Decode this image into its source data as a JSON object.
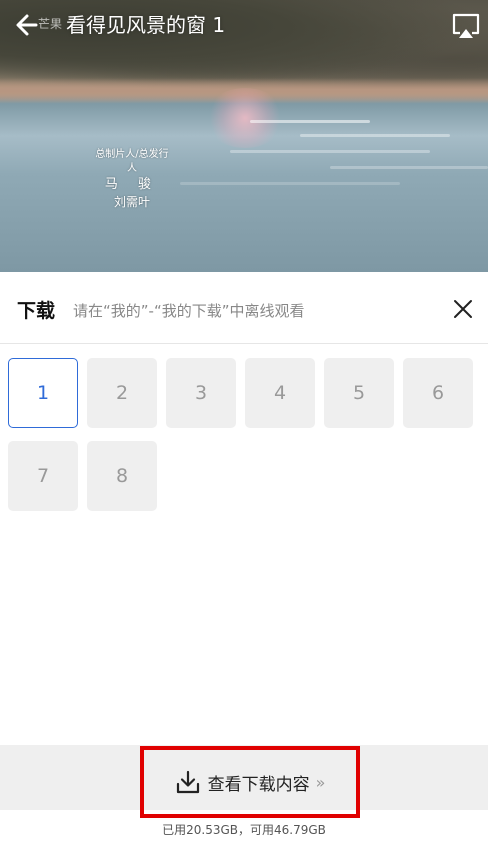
{
  "player": {
    "brand_logo": "芒果",
    "title": "看得见风景的窗 1",
    "credits": {
      "line1": "总制片人/总发行人",
      "line2": "马 骏",
      "line3": "刘需叶"
    }
  },
  "download_panel": {
    "title": "下载",
    "hint": "请在“我的”-“我的下载”中离线观看",
    "episodes": [
      "1",
      "2",
      "3",
      "4",
      "5",
      "6",
      "7",
      "8"
    ],
    "selected_episode": "1"
  },
  "footer": {
    "view_downloads_label": "查看下载内容",
    "chevron": "»",
    "storage_text": "已用20.53GB，可用46.79GB"
  },
  "colors": {
    "accent": "#2f6bd8",
    "highlight_box": "#e00000"
  }
}
